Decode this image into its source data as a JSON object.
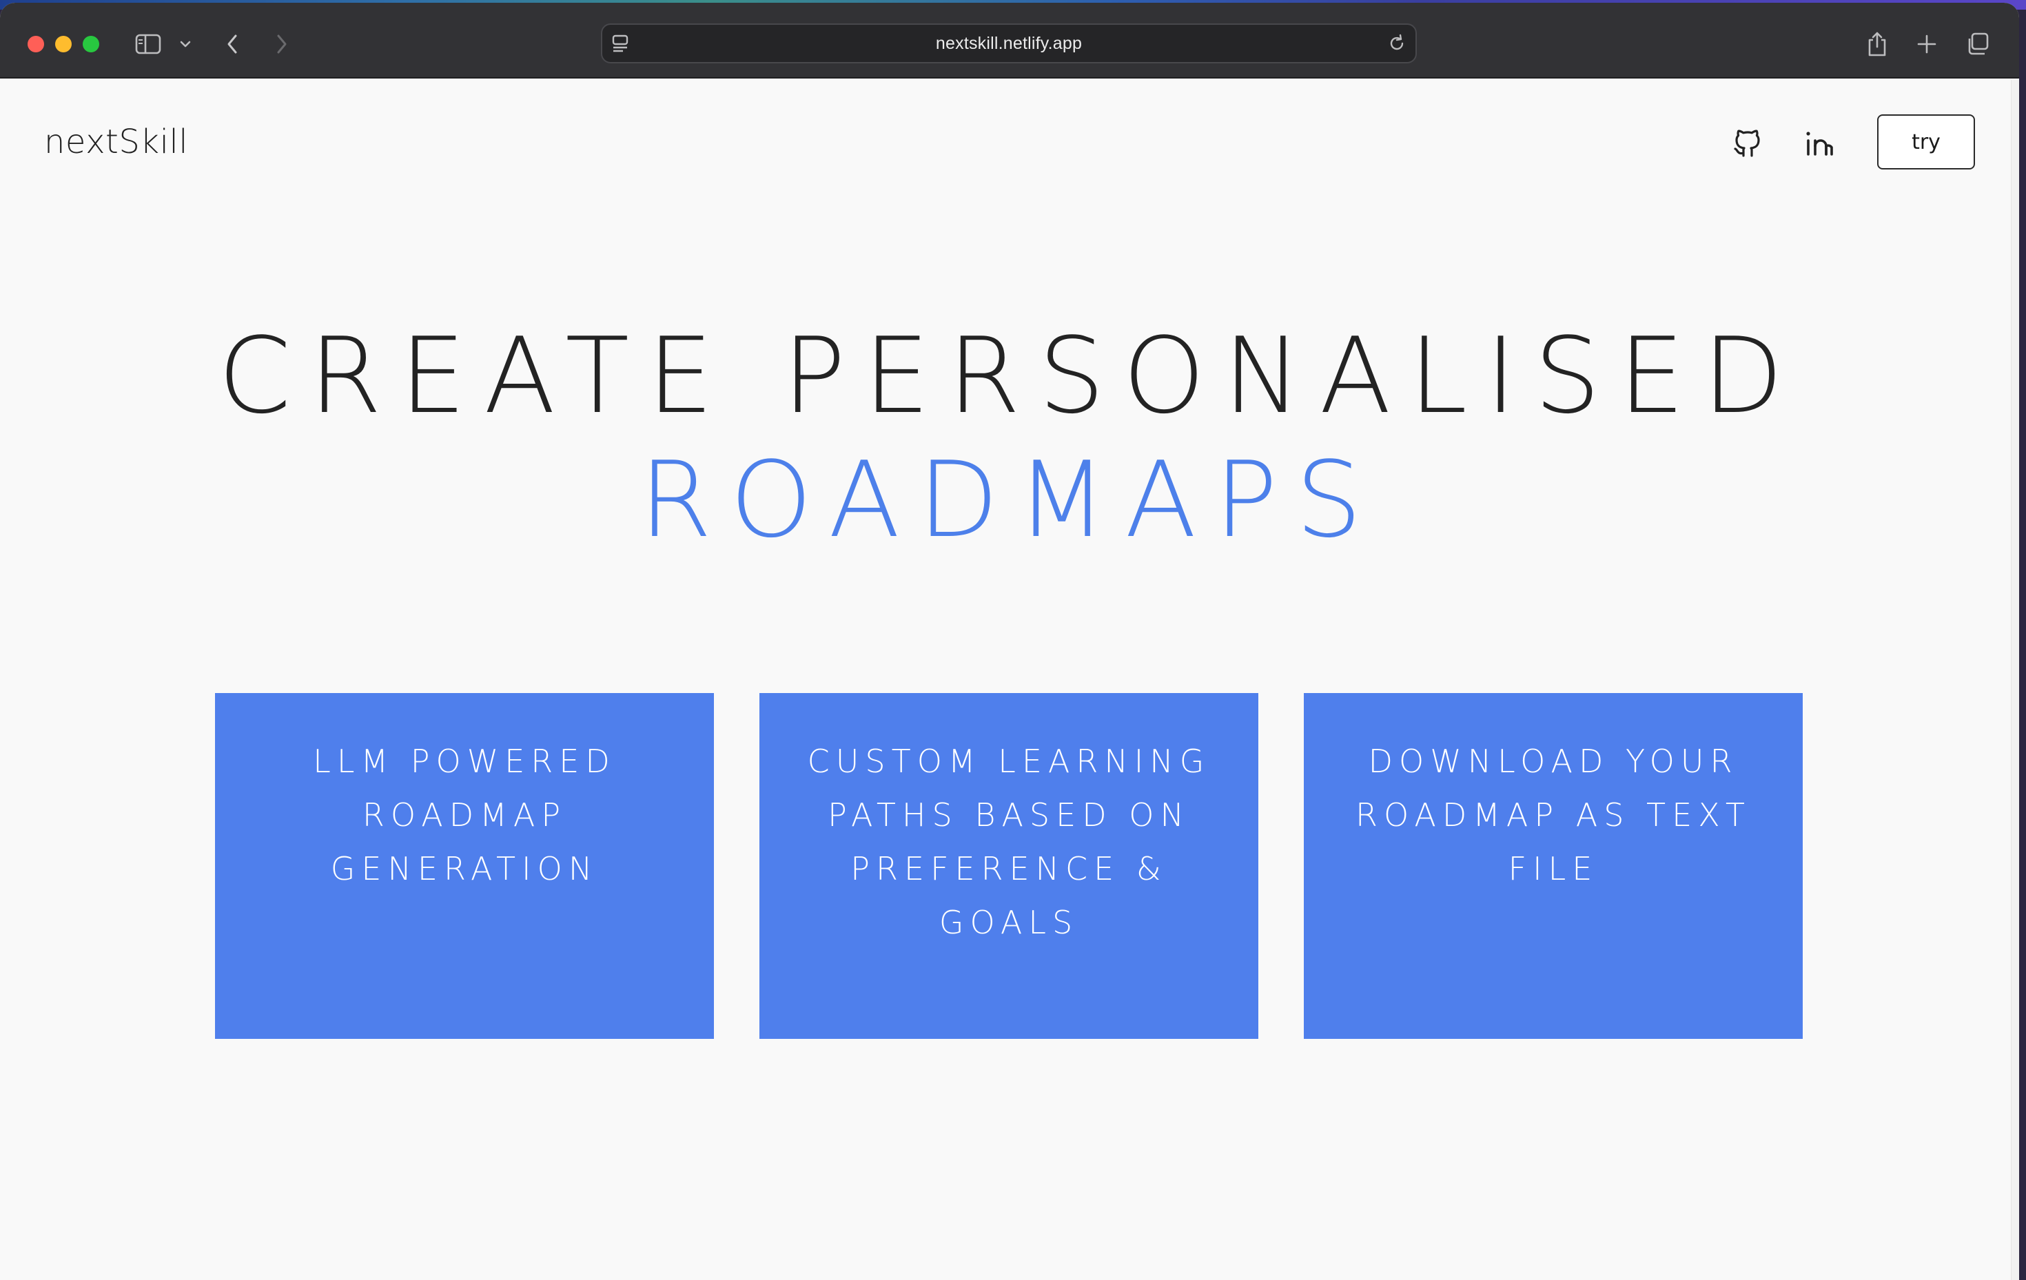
{
  "browser": {
    "url": "nextskill.netlify.app",
    "icons": [
      "sidebar-icon",
      "chevron-down-icon",
      "back-icon",
      "forward-icon",
      "reader-icon",
      "reload-icon",
      "share-icon",
      "new-tab-icon",
      "tab-overview-icon"
    ]
  },
  "nav": {
    "brand": "nextSkill",
    "try_label": "try",
    "icons": [
      "github-icon",
      "linkedin-icon"
    ]
  },
  "hero": {
    "line1": "CREATE PERSONALISED",
    "line2": "ROADMAPS",
    "accent_color": "#4d80ea"
  },
  "features": [
    {
      "text": "LLM POWERED ROADMAP GENERATION"
    },
    {
      "text": "CUSTOM LEARNING PATHS BASED ON PREFERENCE & GOALS"
    },
    {
      "text": "DOWNLOAD YOUR ROADMAP AS TEXT FILE"
    }
  ],
  "colors": {
    "card_background": "#4f7fec",
    "page_background": "#f9f9f9",
    "toolbar_background": "#323235"
  }
}
